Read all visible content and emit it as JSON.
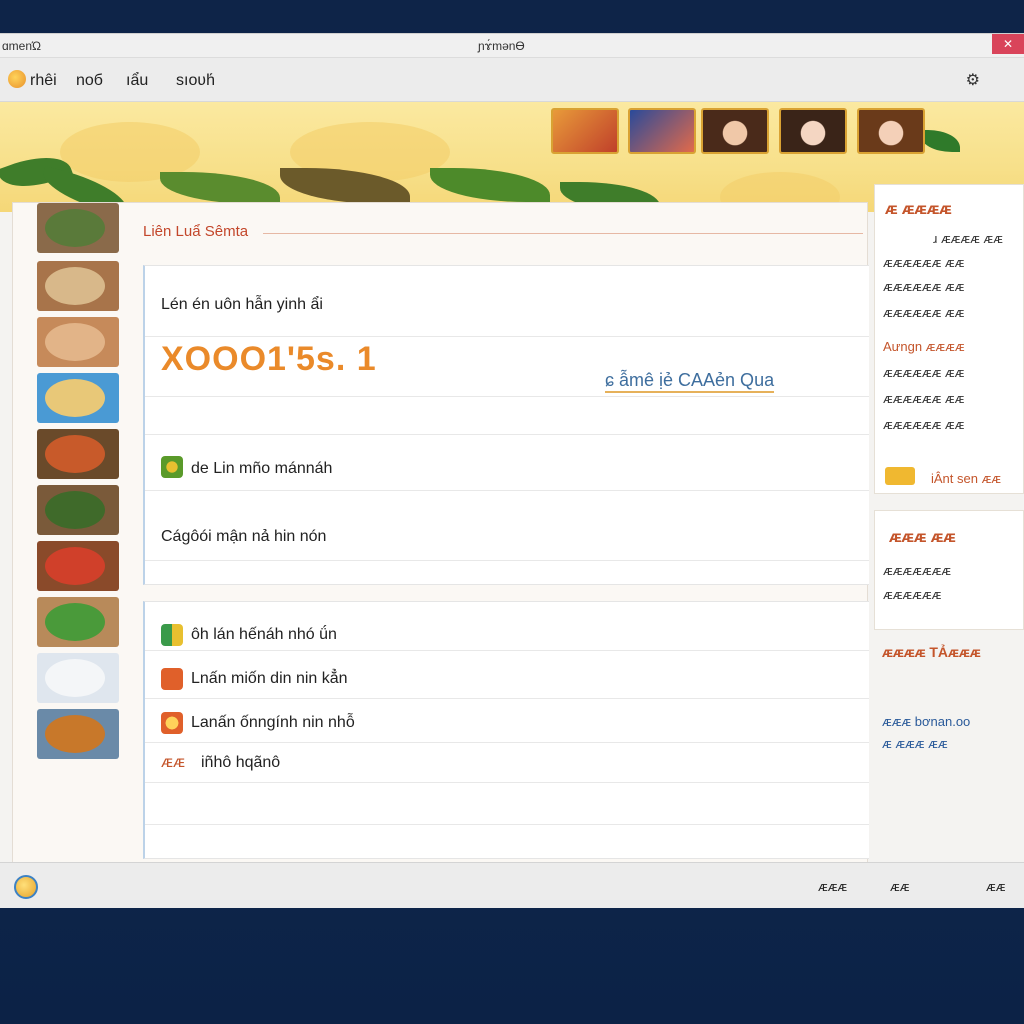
{
  "window": {
    "app_name": "ɑmenΏ",
    "title": "ɲɤ́mənӨ"
  },
  "menu": {
    "items": [
      "rhêi",
      "noб",
      "ıẩu",
      "sıoʋh́"
    ]
  },
  "banner": {
    "thumbnails": [
      "thumb-1",
      "thumb-2",
      "thumb-3",
      "thumb-4",
      "thumb-5"
    ]
  },
  "main": {
    "section_title": "Liên Luẩ Sêmta",
    "card1": {
      "row1": "Lén én uôn hẫn yinh ẩi",
      "big_number": "XOOO1'5s. 1",
      "link": "ɕ ẫmê ịẻ CAAẻn Qua",
      "row3": "de Lin mño mánnáh",
      "row4": "Cágôói mận nả hin nón"
    },
    "card2": {
      "row1": "ôh lán hếnáh nhó ǘn",
      "row2": "Lnấn miốn din nin kẳn",
      "row3": "Lanấn ốnngính nin nhỗ",
      "row4": "iñhô hqãnô",
      "row4_prefix": "ᴁᴁ"
    }
  },
  "right_panel": {
    "box1_title": "ᴁ ᴁᴁᴁᴁ",
    "box1_lines": [
      "ɹ ᴁᴁᴁᴁ ᴁᴁ",
      "ᴁᴁᴁᴁᴁᴁ ᴁᴁ",
      "ᴁᴁᴁᴁᴁᴁ ᴁᴁ",
      "ᴁᴁᴁᴁᴁᴁ ᴁᴁ"
    ],
    "box1_sub": "Aưngn ᴁᴁᴁᴁ",
    "box1_lines2": [
      "ᴁᴁᴁᴁᴁᴁ ᴁᴁ",
      "ᴁᴁᴁᴁᴁᴁ ᴁᴁ",
      "ᴁᴁᴁᴁᴁᴁ ᴁᴁ"
    ],
    "box1_footer": "iÂnt sen ᴁᴁ",
    "box2_title": "ᴁᴁᴁ ᴁᴁ",
    "box2_lines": [
      "ᴁᴁᴁᴁᴁᴁᴁ",
      "ᴁᴁᴁᴁᴁᴁ"
    ],
    "box3_title": "ᴁᴁᴁᴁ TẢᴁᴁᴁ",
    "link_line1": "ᴁᴁᴁ bơnan.oo",
    "link_line2": "ᴁ ᴁᴁᴁ ᴁᴁ"
  },
  "status": {
    "right_text": "ᴁᴁᴁ",
    "right_icon_text": "ᴁᴁ",
    "far_right": "ᴁᴁ"
  }
}
